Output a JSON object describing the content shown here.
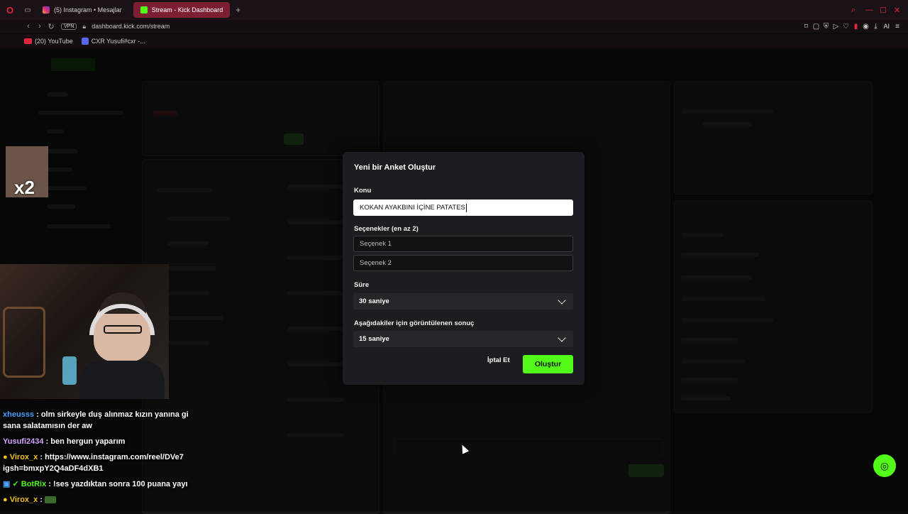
{
  "browser": {
    "tabs": [
      {
        "label": "(5) Instagram • Mesajlar"
      },
      {
        "label": "Stream - Kick Dashboard"
      }
    ],
    "new_tab": "+",
    "vpn": "VPN",
    "url": "dashboard.kick.com/stream",
    "bookmarks": [
      {
        "label": "(20) YouTube"
      },
      {
        "label": "CXR Yusufi#cxr -..."
      }
    ],
    "ai_label": "AI"
  },
  "modal": {
    "title": "Yeni bir Anket Oluştur",
    "topic_label": "Konu",
    "topic_value": "KOKAN AYAKBINI İÇİNE PATATES",
    "options_label": "Seçenekler (en az 2)",
    "option1_placeholder": "Seçenek 1",
    "option2_placeholder": "Seçenek 2",
    "duration_label": "Süre",
    "duration_value": "30 saniye",
    "result_label": "Aşağıdakiler için görüntülenen sonuç",
    "result_value": "15 saniye",
    "cancel_label": "İptal Et",
    "create_label": "Oluştur"
  },
  "stream": {
    "emote_text": "x2",
    "chat": [
      {
        "user": "xheusss",
        "user_color": "#4fa3ff",
        "text": ": olm sirkeyle duş alınmaz kızın yanına gi sana salatamısın der aw"
      },
      {
        "user": "Yusufi2434",
        "user_color": "#d4a6ff",
        "text": ": ben hergun yaparım"
      },
      {
        "user": "Virox_x",
        "user_color": "#f5c518",
        "text": ": https://www.instagram.com/reel/DVe7 igsh=bmxpY2Q4aDF4dXB1"
      },
      {
        "user": "BotRix",
        "user_color": "#53fc18",
        "text": ": !ses yazdıktan sonra 100 puana yayı"
      },
      {
        "user": "Virox_x",
        "user_color": "#f5c518",
        "text": ":"
      }
    ]
  },
  "colors": {
    "accent": "#53fc18",
    "tab_active": "#7d1f33"
  }
}
